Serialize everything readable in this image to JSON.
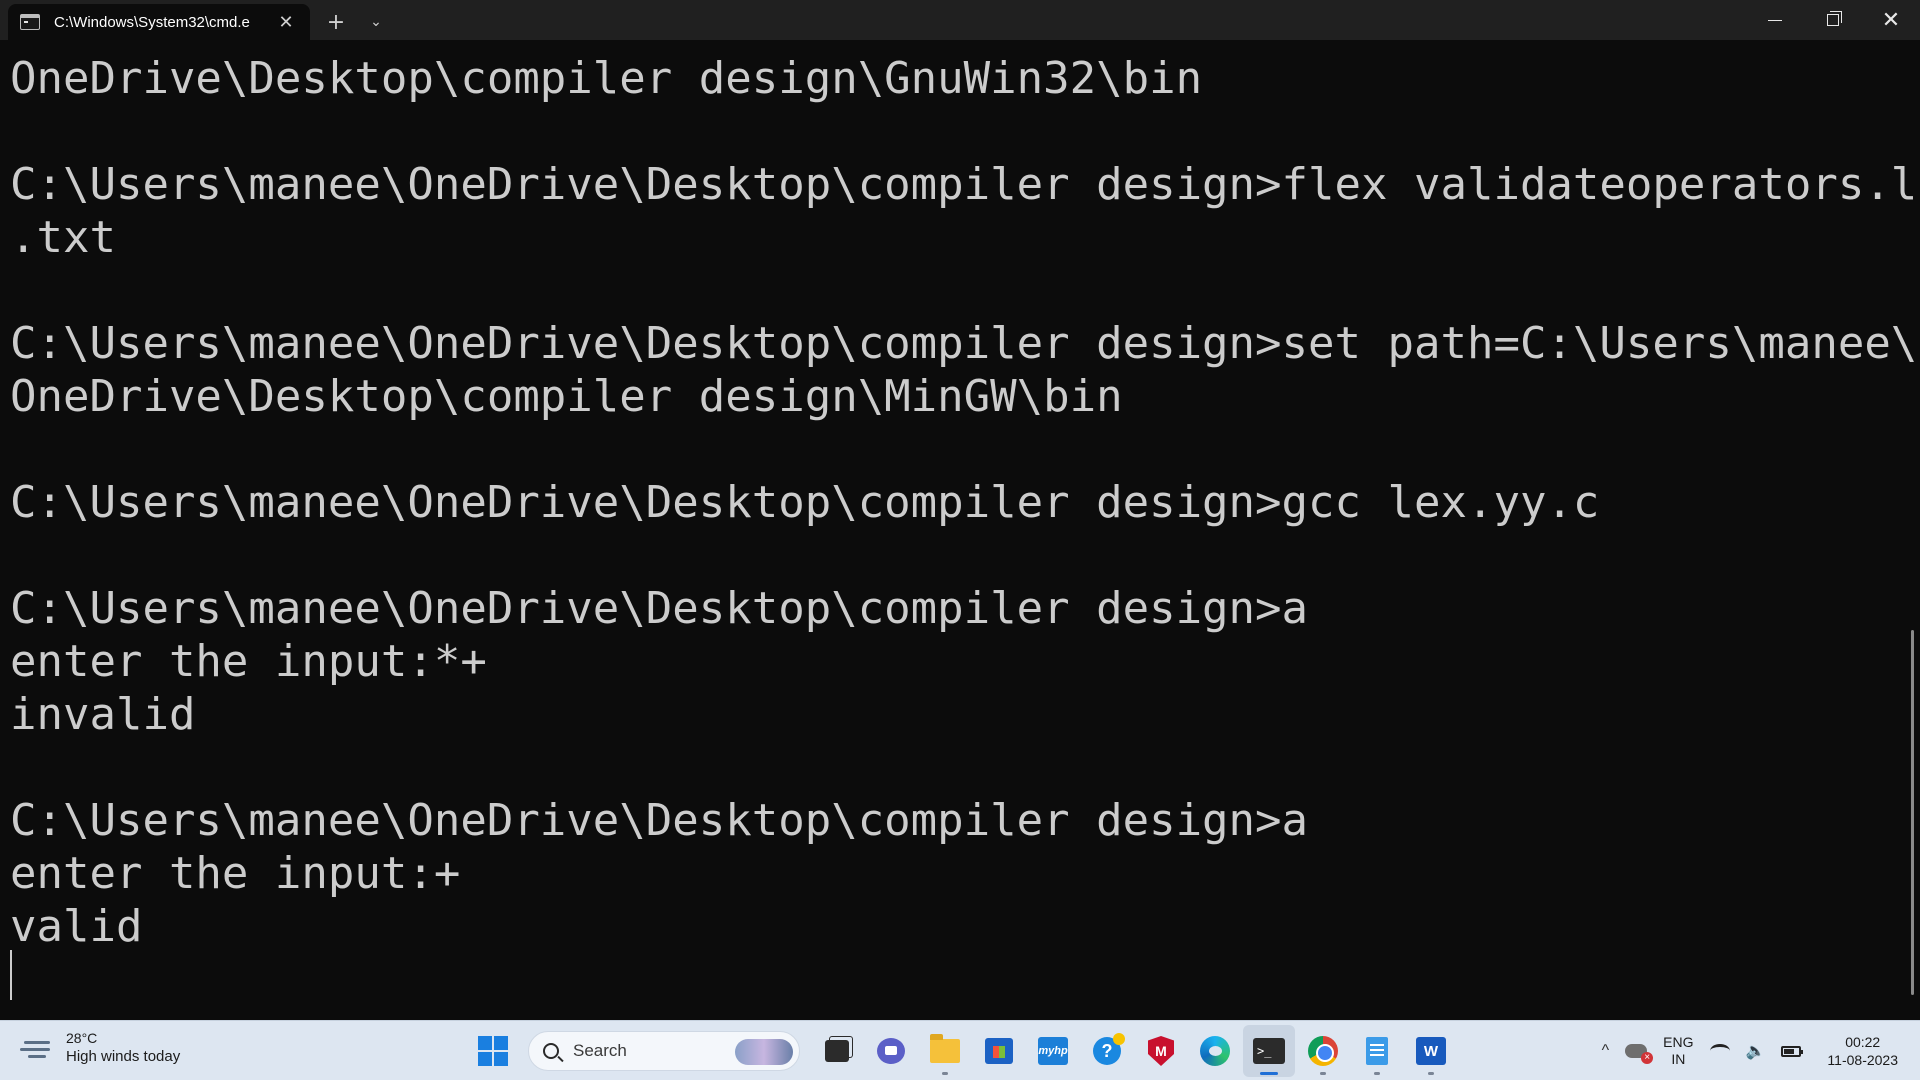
{
  "window": {
    "tab_title": "C:\\Windows\\System32\\cmd.e",
    "tab_close_glyph": "✕",
    "new_tab_glyph": "+",
    "dropdown_glyph": "⌄",
    "close_glyph": "✕"
  },
  "terminal": {
    "lines": [
      "OneDrive\\Desktop\\compiler design\\GnuWin32\\bin",
      "",
      "C:\\Users\\manee\\OneDrive\\Desktop\\compiler design>flex validateoperators.l",
      ".txt",
      "",
      "C:\\Users\\manee\\OneDrive\\Desktop\\compiler design>set path=C:\\Users\\manee\\",
      "OneDrive\\Desktop\\compiler design\\MinGW\\bin",
      "",
      "C:\\Users\\manee\\OneDrive\\Desktop\\compiler design>gcc lex.yy.c",
      "",
      "C:\\Users\\manee\\OneDrive\\Desktop\\compiler design>a",
      "enter the input:*+",
      "invalid",
      "",
      "C:\\Users\\manee\\OneDrive\\Desktop\\compiler design>a",
      "enter the input:+",
      "valid"
    ],
    "text_color": "#cccccc",
    "background": "#0c0c0c"
  },
  "taskbar": {
    "weather": {
      "temp": "28°C",
      "desc": "High winds today"
    },
    "search": {
      "label": "Search"
    },
    "word_letter": "W",
    "hp_label": "myhp",
    "help_glyph": "?",
    "mcafee_letter": "M",
    "term_glyph": ">_",
    "apps": [
      "start-icon",
      "task-view-icon",
      "teams-chat-icon",
      "file-explorer-icon",
      "microsoft-store-icon",
      "myhp-icon",
      "get-help-icon",
      "mcafee-icon",
      "edge-icon",
      "terminal-icon",
      "chrome-icon",
      "notepad-icon",
      "word-icon"
    ],
    "tray": {
      "chevron": "^",
      "lang_top": "ENG",
      "lang_bottom": "IN",
      "volume_glyph": "🔈",
      "time": "00:22",
      "date": "11-08-2023"
    }
  }
}
